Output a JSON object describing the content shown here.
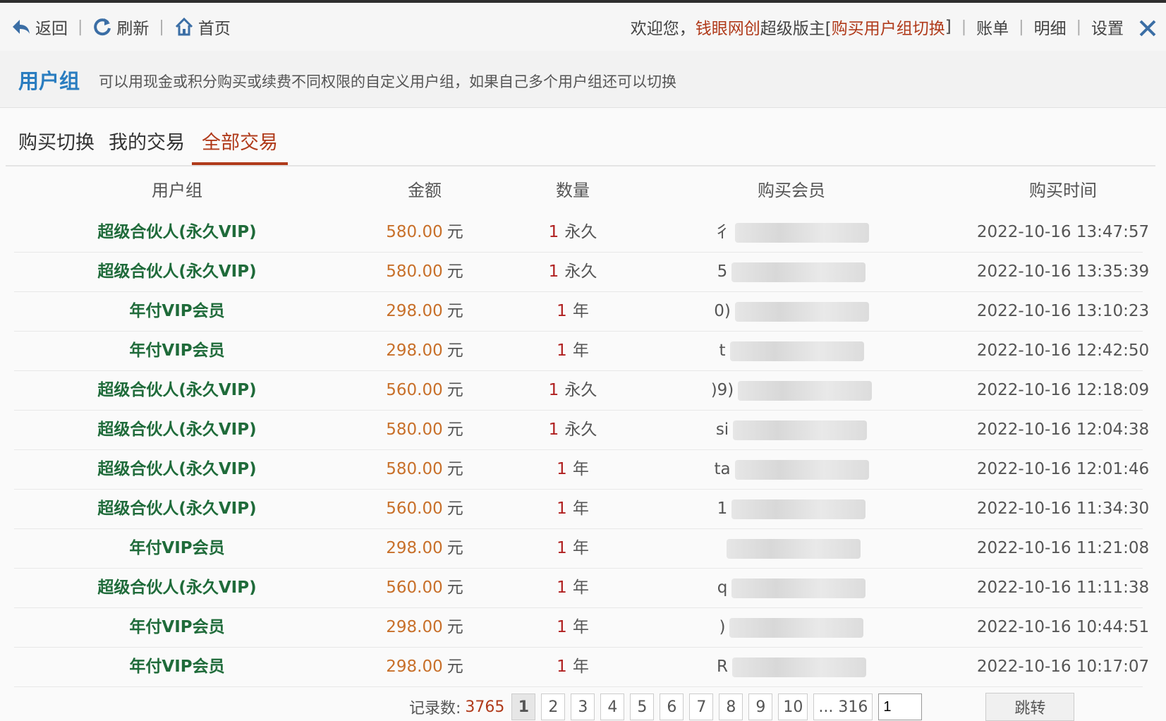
{
  "toolbar": {
    "back_label": "返回",
    "refresh_label": "刷新",
    "home_label": "首页",
    "sep": "|"
  },
  "user": {
    "welcome": "欢迎您，",
    "name": "钱眼网创",
    "role": " 超级版主[",
    "switch_label": "购买用户组切换",
    "role_end": "]",
    "links": [
      "账单",
      "明细",
      "设置"
    ]
  },
  "intro": {
    "title": "用户组",
    "desc": "可以用现金或积分购买或续费不同权限的自定义用户组，如果自己多个用户组还可以切换"
  },
  "tabs": [
    "购买切换",
    "我的交易",
    "全部交易"
  ],
  "table": {
    "headers": [
      "用户组",
      "金额",
      "数量",
      "购买会员",
      "购买时间"
    ],
    "rows": [
      {
        "group": "超级合伙人(永久VIP)",
        "amount": "580.00",
        "unit": "元",
        "qty": "1",
        "qty_unit": "永久",
        "member": "彳",
        "time": "2022-10-16 13:47:57"
      },
      {
        "group": "超级合伙人(永久VIP)",
        "amount": "580.00",
        "unit": "元",
        "qty": "1",
        "qty_unit": "永久",
        "member": "5",
        "time": "2022-10-16 13:35:39"
      },
      {
        "group": "年付VIP会员",
        "amount": "298.00",
        "unit": "元",
        "qty": "1",
        "qty_unit": "年",
        "member": "0)",
        "time": "2022-10-16 13:10:23"
      },
      {
        "group": "年付VIP会员",
        "amount": "298.00",
        "unit": "元",
        "qty": "1",
        "qty_unit": "年",
        "member": "t",
        "time": "2022-10-16 12:42:50"
      },
      {
        "group": "超级合伙人(永久VIP)",
        "amount": "560.00",
        "unit": "元",
        "qty": "1",
        "qty_unit": "永久",
        "member": ")9)",
        "time": "2022-10-16 12:18:09"
      },
      {
        "group": "超级合伙人(永久VIP)",
        "amount": "580.00",
        "unit": "元",
        "qty": "1",
        "qty_unit": "永久",
        "member": "si",
        "time": "2022-10-16 12:04:38"
      },
      {
        "group": "超级合伙人(永久VIP)",
        "amount": "580.00",
        "unit": "元",
        "qty": "1",
        "qty_unit": "年",
        "member": "ta",
        "time": "2022-10-16 12:01:46"
      },
      {
        "group": "超级合伙人(永久VIP)",
        "amount": "560.00",
        "unit": "元",
        "qty": "1",
        "qty_unit": "年",
        "member": "1",
        "time": "2022-10-16 11:34:30"
      },
      {
        "group": "年付VIP会员",
        "amount": "298.00",
        "unit": "元",
        "qty": "1",
        "qty_unit": "年",
        "member": "",
        "time": "2022-10-16 11:21:08"
      },
      {
        "group": "超级合伙人(永久VIP)",
        "amount": "560.00",
        "unit": "元",
        "qty": "1",
        "qty_unit": "年",
        "member": "q",
        "time": "2022-10-16 11:11:38"
      },
      {
        "group": "年付VIP会员",
        "amount": "298.00",
        "unit": "元",
        "qty": "1",
        "qty_unit": "年",
        "member": ")",
        "time": "2022-10-16 10:44:51"
      },
      {
        "group": "年付VIP会员",
        "amount": "298.00",
        "unit": "元",
        "qty": "1",
        "qty_unit": "年",
        "member": "R",
        "time": "2022-10-16 10:17:07"
      }
    ]
  },
  "pager": {
    "record_label": "记录数:",
    "record_count": "3765",
    "pages": [
      "1",
      "2",
      "3",
      "4",
      "5",
      "6",
      "7",
      "8",
      "9",
      "10",
      "... 316"
    ],
    "current": "1",
    "jump_value": "1",
    "go_label": "跳转"
  },
  "colors": {
    "accent": "#b03a1a",
    "title_blue": "#2a7dc0",
    "group_green": "#1f6b3a",
    "amount_orange": "#c8702a"
  }
}
